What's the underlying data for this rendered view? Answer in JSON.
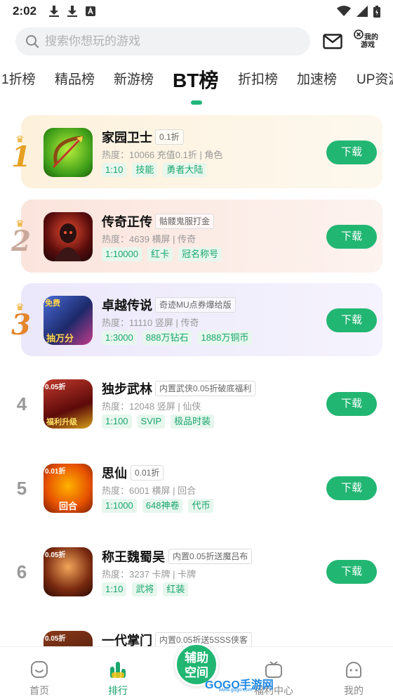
{
  "status_bar": {
    "time": "2:02",
    "icons_left": [
      "download-icon",
      "download-icon",
      "a-icon"
    ],
    "icons_right": [
      "wifi-icon",
      "signal-icon",
      "battery-icon"
    ]
  },
  "search": {
    "placeholder": "搜索你想玩的游戏",
    "mail_icon": "mail-icon",
    "my_games_label_1": "我的",
    "my_games_label_2": "游戏"
  },
  "tabs": [
    {
      "label": "1折榜",
      "active": false
    },
    {
      "label": "精品榜",
      "active": false
    },
    {
      "label": "新游榜",
      "active": false
    },
    {
      "label": "BT榜",
      "active": true
    },
    {
      "label": "折扣榜",
      "active": false
    },
    {
      "label": "加速榜",
      "active": false
    },
    {
      "label": "UP资源",
      "active": false
    }
  ],
  "colors": {
    "accent": "#22b673",
    "chip_text": "#1aa56c",
    "chip_bg": "#e7f7ee",
    "rank1_bg": "#fdf3e0",
    "rank2_bg": "#fbe9e4",
    "rank3_bg": "#eeebfb"
  },
  "games": [
    {
      "rank": "1",
      "name": "家园卫士",
      "tag": "0.1折",
      "meta": "热度：10066   充值0.1折 | 角色",
      "chips": [
        "1:10",
        "技能",
        "勇者大陆"
      ],
      "button": "下载"
    },
    {
      "rank": "2",
      "name": "传奇正传",
      "tag": "骷髅鬼服打金",
      "meta": "热度：4639   横屏 | 传奇",
      "chips": [
        "1:10000",
        "红卡",
        "冠名称号"
      ],
      "button": "下载"
    },
    {
      "rank": "3",
      "name": "卓越传说",
      "tag": "奇迹MU点券爆给版",
      "meta": "热度：11110   竖屏 | 传奇",
      "chips": [
        "1:3000",
        "888万钻石",
        "1888万铜币"
      ],
      "button": "下载",
      "icon_text_1": "免费",
      "icon_text_2": "抽万分"
    },
    {
      "rank": "4",
      "name": "独步武林",
      "tag": "内置武侠0.05折破底福利",
      "meta": "热度：12048   竖屏 | 仙侠",
      "chips": [
        "1:100",
        "SVIP",
        "极品时装"
      ],
      "button": "下载",
      "icon_text_1": "0.05折",
      "icon_text_2": "福利升级"
    },
    {
      "rank": "5",
      "name": "思仙",
      "tag": "0.01折",
      "meta": "热度：6001   横屏 | 回合",
      "chips": [
        "1:1000",
        "648神卷",
        "代币"
      ],
      "button": "下载",
      "icon_text_1": "0.01折",
      "icon_text_2": "回合"
    },
    {
      "rank": "6",
      "name": "称王魏蜀吴",
      "tag": "内置0.05折送魔吕布",
      "meta": "热度：3237   卡牌 | 卡牌",
      "chips": [
        "1:10",
        "武将",
        "红装"
      ],
      "button": "下载",
      "icon_text_1": "0.05折"
    },
    {
      "rank": "",
      "name": "一代掌门",
      "tag": "内置0.05折送5SSS侠客",
      "meta": "",
      "chips": [],
      "button": "",
      "icon_text_1": "0.05折"
    }
  ],
  "bottom_nav": {
    "home": "首页",
    "rank": "排行",
    "center_line1": "辅助",
    "center_line2": "空间",
    "welfare": "福利中心",
    "mine": "我的"
  },
  "watermark": {
    "text": "GOGO手游网",
    "sub": "www.gogo.com"
  }
}
